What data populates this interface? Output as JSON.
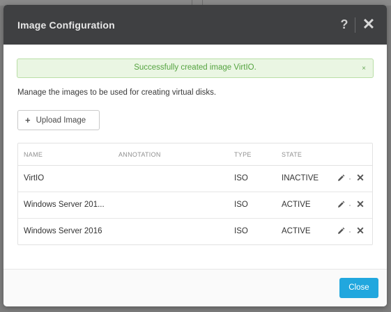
{
  "modal": {
    "title": "Image Configuration",
    "help_label": "?",
    "close_icon": "close-icon"
  },
  "alert": {
    "message": "Successfully created image VirtIO.",
    "dismiss": "×",
    "status_color": "#54a340"
  },
  "description": "Manage the images to be used for creating virtual disks.",
  "upload_button": {
    "icon": "plus-icon",
    "label": "Upload Image"
  },
  "table": {
    "columns": [
      "NAME",
      "ANNOTATION",
      "TYPE",
      "STATE"
    ],
    "rows": [
      {
        "name": "VirtIO",
        "annotation": "",
        "type": "ISO",
        "state": "INACTIVE"
      },
      {
        "name": "Windows Server 201...",
        "annotation": "",
        "type": "ISO",
        "state": "ACTIVE"
      },
      {
        "name": "Windows Server 2016",
        "annotation": "",
        "type": "ISO",
        "state": "ACTIVE"
      }
    ]
  },
  "footer": {
    "close_label": "Close",
    "accent_color": "#21a7de"
  }
}
